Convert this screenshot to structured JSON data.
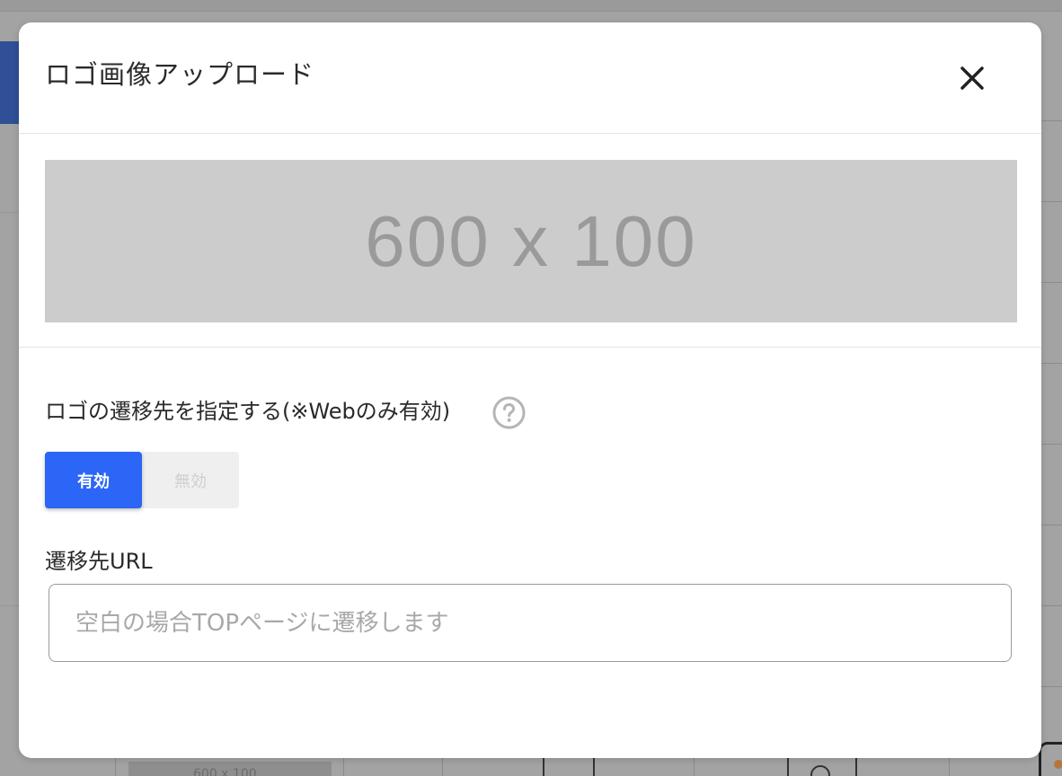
{
  "modal": {
    "title": "ロゴ画像アップロード",
    "close_icon": "close-icon"
  },
  "preview": {
    "placeholder_text": "600 x 100",
    "background_color": "#cccccc"
  },
  "link_setting": {
    "label": "ロゴの遷移先を指定する(※Webのみ有効)",
    "help_icon": "question-circle-icon",
    "toggle": {
      "on_label": "有効",
      "off_label": "無効",
      "selected": "有効",
      "accent_color": "#2b66f6"
    }
  },
  "url_field": {
    "label": "遷移先URL",
    "value": "",
    "placeholder": "空白の場合TOPページに遷移します"
  },
  "background": {
    "thumbnail_text": "600 x 100"
  }
}
